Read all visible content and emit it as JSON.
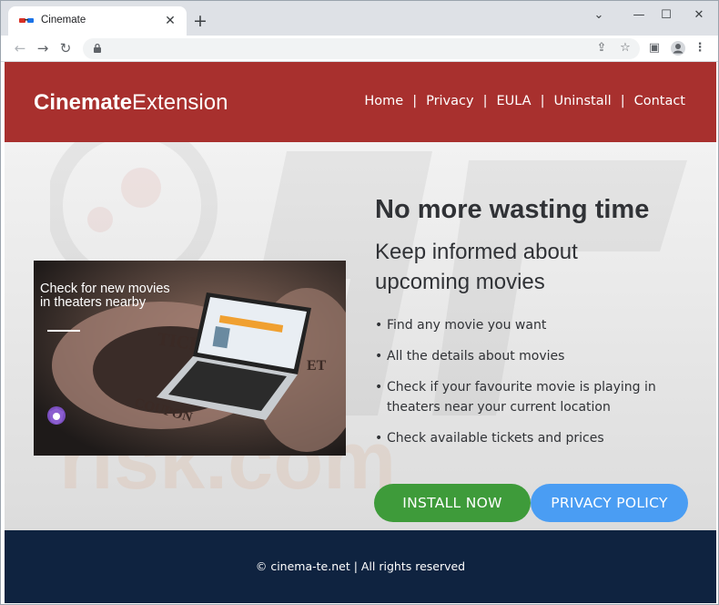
{
  "browser": {
    "tab_title": "Cinemate",
    "tab_close": "✕",
    "new_tab": "+",
    "minimize": "⌄",
    "restore": "—",
    "maximize": "☐",
    "close": "✕",
    "icons": [
      "back-icon",
      "forward-icon",
      "reload-icon",
      "lock-icon",
      "share-icon",
      "star-icon",
      "sidepanel-icon",
      "profile-icon",
      "menu-icon"
    ]
  },
  "header": {
    "brand_bold": "Cinemate",
    "brand_regular": "Extension",
    "nav": [
      "Home",
      "Privacy",
      "EULA",
      "Uninstall",
      "Contact"
    ],
    "separator": "|",
    "background": "#a8302e"
  },
  "hero": {
    "promo_text": "Check for new movies in theaters nearby",
    "title": "No more wasting time",
    "subtitle": "Keep informed about upcoming movies",
    "features": [
      "Find any movie you want",
      "All the details about movies",
      "Check if your favourite movie is playing in theaters near your current location",
      "Check available tickets and prices"
    ],
    "install_button": "INSTALL NOW",
    "privacy_button": "PRIVACY POLICY",
    "install_color": "#3e9b3a",
    "privacy_color": "#4a9df3"
  },
  "footer": {
    "text": "© cinema-te.net | All rights reserved",
    "background": "#0f2340"
  }
}
